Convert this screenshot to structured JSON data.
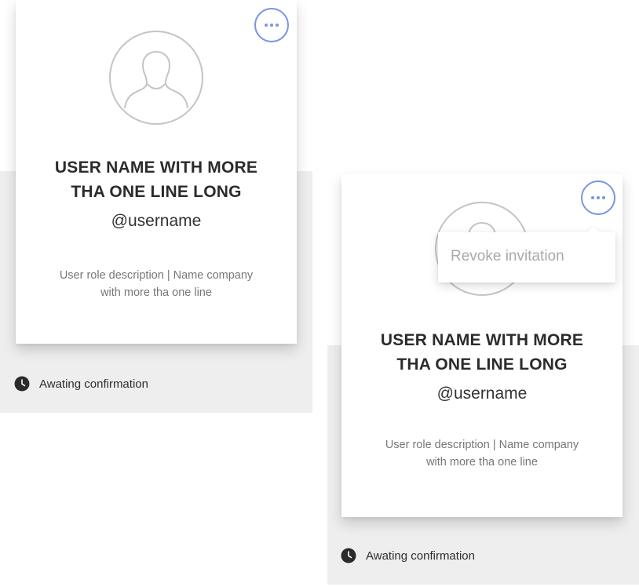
{
  "colors": {
    "accent": "#7b93e6",
    "status_bg": "#eeeeee",
    "card_bg": "#ffffff",
    "text_dark": "#2b2b2b",
    "text_muted": "#777777",
    "menu_text": "#a9a9a9"
  },
  "cards": [
    {
      "name_line1": "USER NAME WITH MORE",
      "name_line2": "THA ONE LINE LONG",
      "handle": "@username",
      "role_line1": "User role description | Name company",
      "role_line2": "with more tha one line",
      "status": "Awating confirmation",
      "avatar_icon": "user-silhouette-icon",
      "status_icon": "clock-icon",
      "menu_icon": "ellipsis-icon"
    },
    {
      "name_line1": "USER NAME WITH MORE",
      "name_line2": "THA ONE LINE LONG",
      "handle": "@username",
      "role_line1": "User role description | Name company",
      "role_line2": "with more tha one line",
      "status": "Awating confirmation",
      "avatar_icon": "user-silhouette-icon",
      "status_icon": "clock-icon",
      "menu_icon": "ellipsis-icon"
    }
  ],
  "dropdown": {
    "items": [
      "Revoke invitation"
    ]
  }
}
